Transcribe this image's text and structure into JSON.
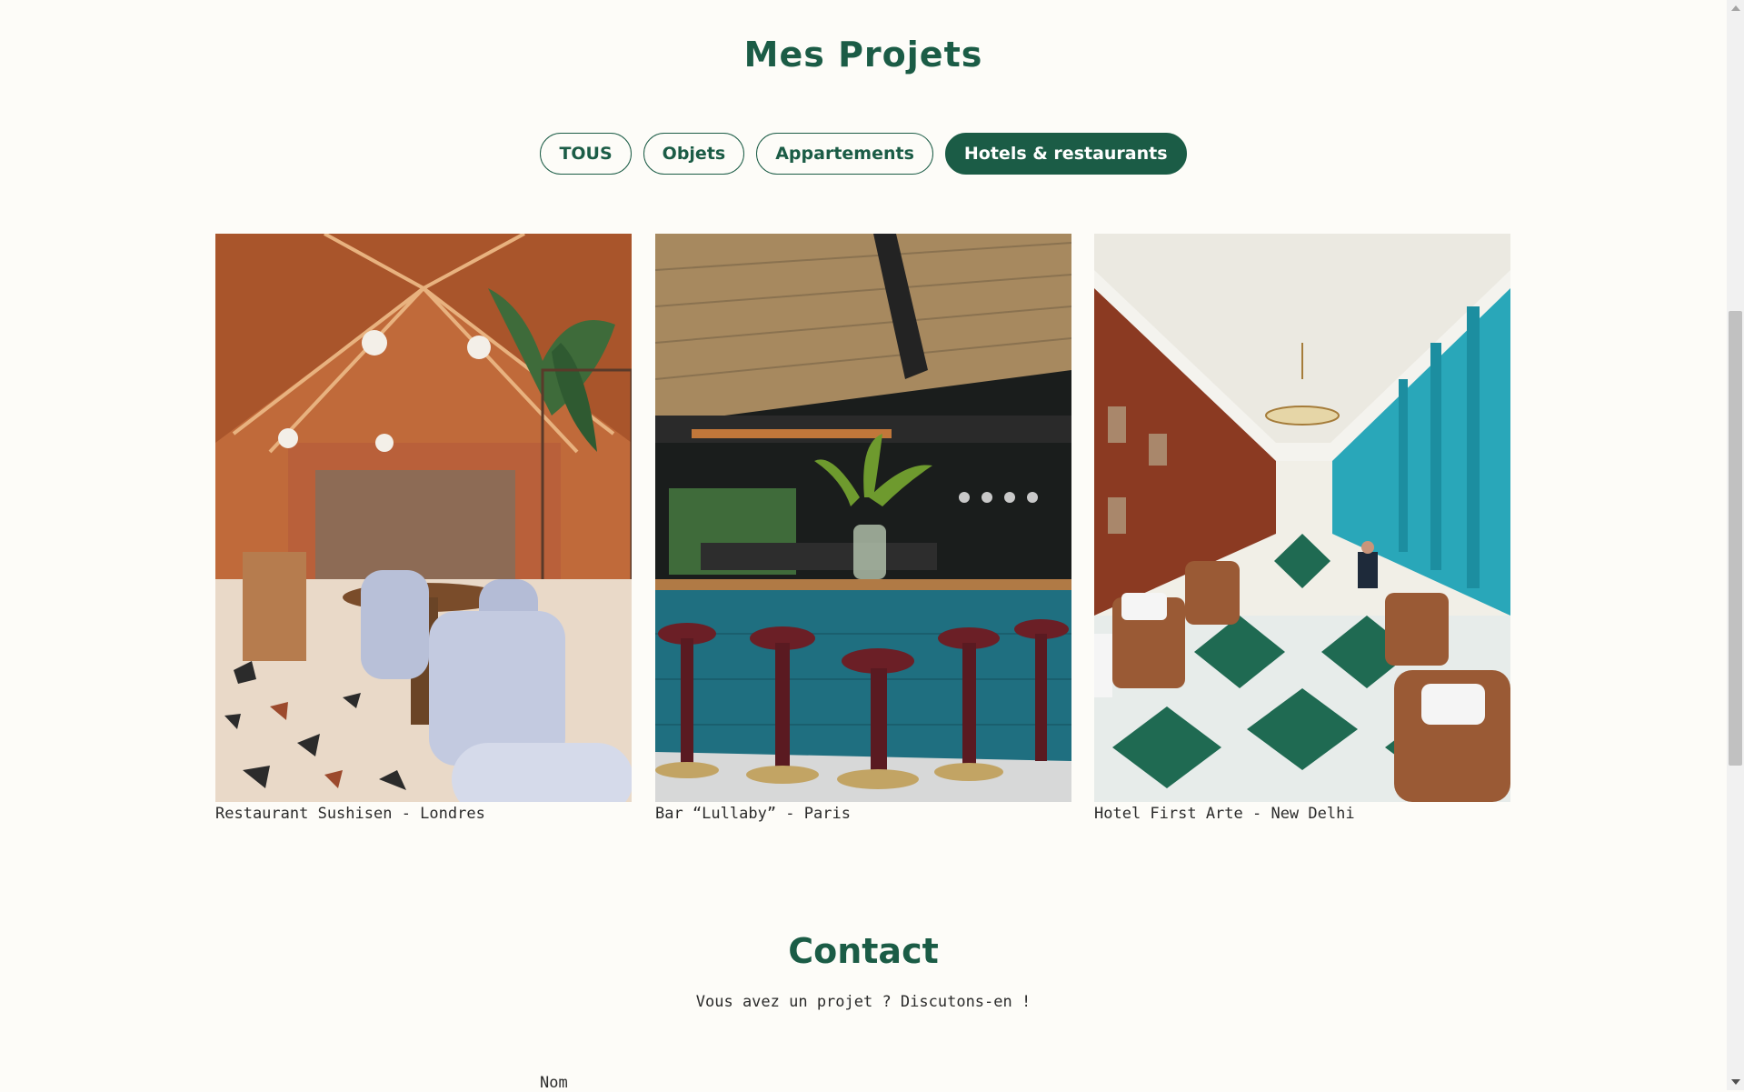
{
  "projects": {
    "title": "Mes Projets",
    "filters": [
      {
        "label": "TOUS",
        "active": false
      },
      {
        "label": "Objets",
        "active": false
      },
      {
        "label": "Appartements",
        "active": false
      },
      {
        "label": "Hotels & restaurants",
        "active": true
      }
    ],
    "cards": [
      {
        "caption": "Restaurant Sushisen - Londres"
      },
      {
        "caption": "Bar “Lullaby” - Paris"
      },
      {
        "caption": "Hotel First Arte - New Delhi"
      }
    ]
  },
  "contact": {
    "title": "Contact",
    "subtitle": "Vous avez un projet ? Discutons-en !",
    "name_label": "Nom"
  },
  "colors": {
    "accent": "#1b5c46",
    "background": "#fdfcf8"
  }
}
